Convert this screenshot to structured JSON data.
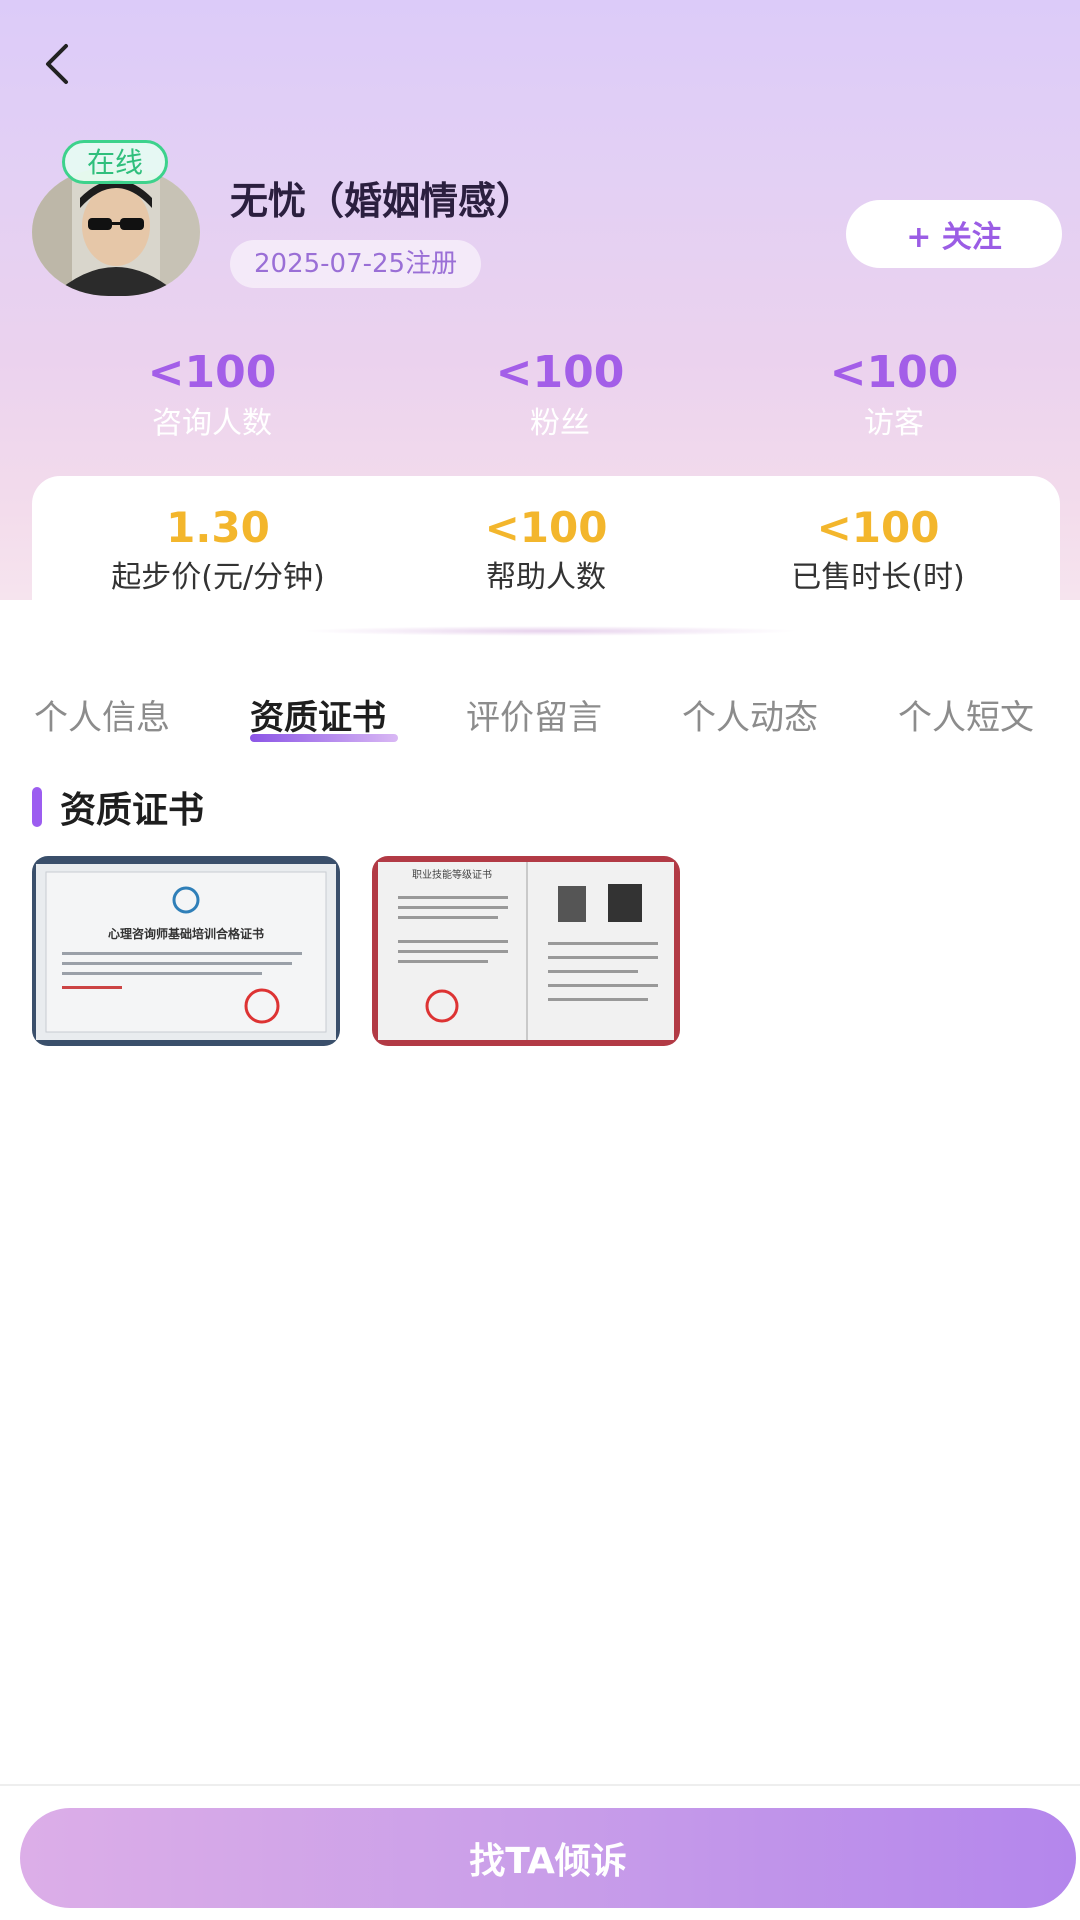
{
  "profile": {
    "status": "在线",
    "name": "无忧（婚姻情感）",
    "registered": "2025-07-25注册",
    "follow_label": "+ 关注"
  },
  "stats_top": [
    {
      "value": "<100",
      "label": "咨询人数"
    },
    {
      "value": "<100",
      "label": "粉丝"
    },
    {
      "value": "<100",
      "label": "访客"
    }
  ],
  "stats_card": [
    {
      "value": "1.30",
      "label": "起步价(元/分钟)"
    },
    {
      "value": "<100",
      "label": "帮助人数"
    },
    {
      "value": "<100",
      "label": "已售时长(时)"
    }
  ],
  "tabs": [
    {
      "label": "个人信息"
    },
    {
      "label": "资质证书",
      "active": true
    },
    {
      "label": "评价留言"
    },
    {
      "label": "个人动态"
    },
    {
      "label": "个人短文"
    }
  ],
  "section": {
    "title": "资质证书"
  },
  "certificates": [
    {
      "title": "心理咨询师基础培训合格证书"
    },
    {
      "title": "职业技能等级证书"
    }
  ],
  "cta": {
    "label": "找TA倾诉"
  },
  "colors": {
    "accent": "#9b5de5",
    "price": "#f3b62c",
    "online": "#2fbf7c"
  }
}
